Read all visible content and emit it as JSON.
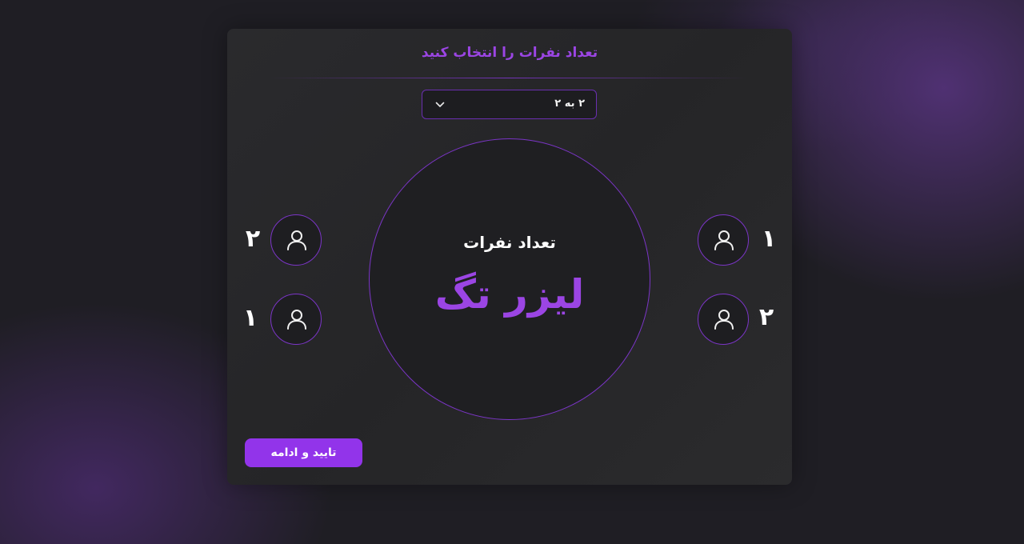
{
  "panel": {
    "title": "تعداد نفرات را انتخاب کنید",
    "team_size_select": {
      "selected": "۲ به ۲",
      "icon": "chevron-down-icon"
    },
    "center": {
      "label": "تعداد نفرات",
      "game_name": "لیزر تگ"
    },
    "team_left": [
      {
        "number": "۲",
        "icon": "user-icon"
      },
      {
        "number": "۱",
        "icon": "user-icon"
      }
    ],
    "team_right": [
      {
        "number": "۱",
        "icon": "user-icon"
      },
      {
        "number": "۲",
        "icon": "user-icon"
      }
    ],
    "confirm_button": "تایید و ادامه"
  },
  "colors": {
    "accent": "#9234ea",
    "title_purple": "#9b45e4",
    "border_purple": "#7b35c7",
    "card_bg": "#2a2a2d",
    "page_bg": "#1f1e24"
  }
}
